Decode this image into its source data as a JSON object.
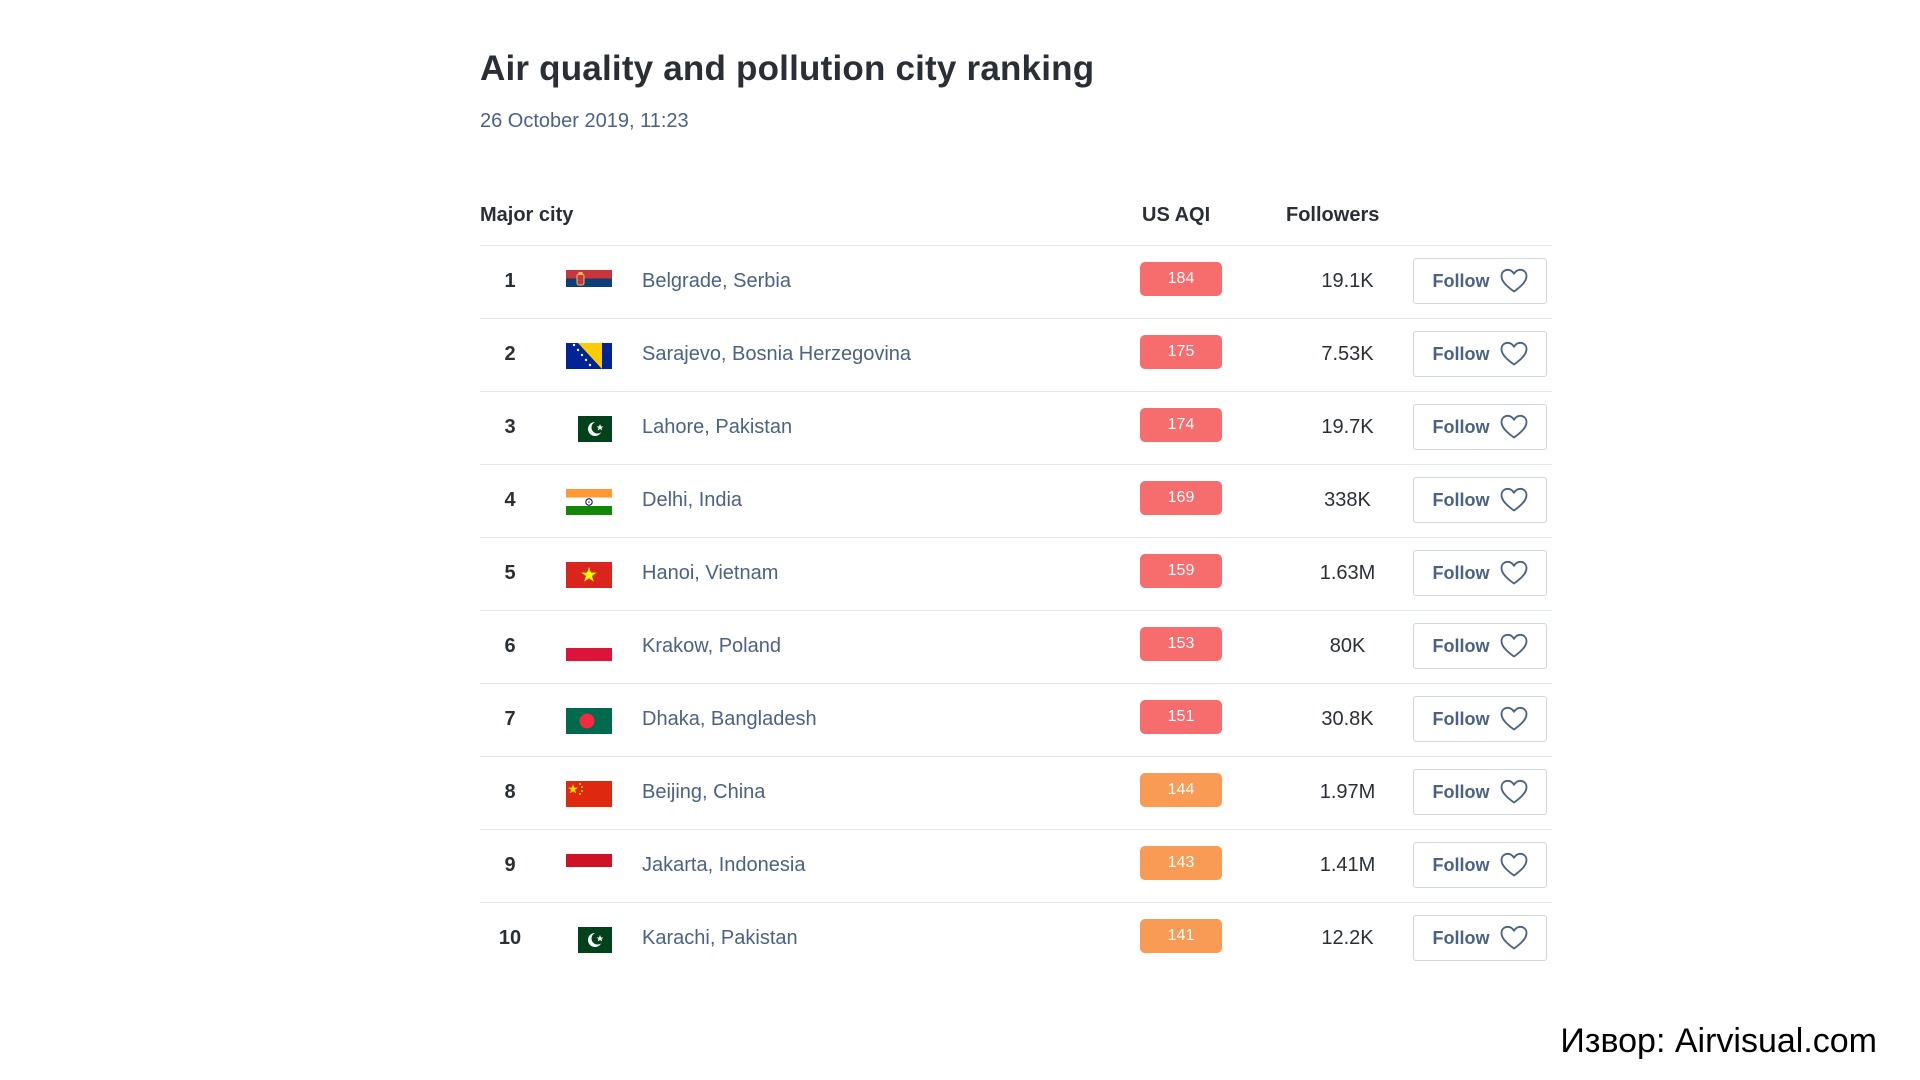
{
  "header": {
    "title": "Air quality and pollution city ranking",
    "date": "26 October 2019, 11:23"
  },
  "table": {
    "columns": {
      "city": "Major city",
      "aqi": "US AQI",
      "followers": "Followers"
    },
    "rows": [
      {
        "rank": "1",
        "flag": "serbia-flag",
        "city": "Belgrade, Serbia",
        "aqi": "184",
        "aqi_color": "#f76d6d",
        "followers": "19.1K",
        "follow_label": "Follow"
      },
      {
        "rank": "2",
        "flag": "bosnia-flag",
        "city": "Sarajevo, Bosnia Herzegovina",
        "aqi": "175",
        "aqi_color": "#f76d6d",
        "followers": "7.53K",
        "follow_label": "Follow"
      },
      {
        "rank": "3",
        "flag": "pakistan-flag",
        "city": "Lahore, Pakistan",
        "aqi": "174",
        "aqi_color": "#f76d6d",
        "followers": "19.7K",
        "follow_label": "Follow"
      },
      {
        "rank": "4",
        "flag": "india-flag",
        "city": "Delhi, India",
        "aqi": "169",
        "aqi_color": "#f76d6d",
        "followers": "338K",
        "follow_label": "Follow"
      },
      {
        "rank": "5",
        "flag": "vietnam-flag",
        "city": "Hanoi, Vietnam",
        "aqi": "159",
        "aqi_color": "#f76d6d",
        "followers": "1.63M",
        "follow_label": "Follow"
      },
      {
        "rank": "6",
        "flag": "poland-flag",
        "city": "Krakow, Poland",
        "aqi": "153",
        "aqi_color": "#f76d6d",
        "followers": "80K",
        "follow_label": "Follow"
      },
      {
        "rank": "7",
        "flag": "bangladesh-flag",
        "city": "Dhaka, Bangladesh",
        "aqi": "151",
        "aqi_color": "#f76d6d",
        "followers": "30.8K",
        "follow_label": "Follow"
      },
      {
        "rank": "8",
        "flag": "china-flag",
        "city": "Beijing, China",
        "aqi": "144",
        "aqi_color": "#fa9b55",
        "followers": "1.97M",
        "follow_label": "Follow"
      },
      {
        "rank": "9",
        "flag": "indonesia-flag",
        "city": "Jakarta, Indonesia",
        "aqi": "143",
        "aqi_color": "#fa9b55",
        "followers": "1.41M",
        "follow_label": "Follow"
      },
      {
        "rank": "10",
        "flag": "pakistan-flag",
        "city": "Karachi, Pakistan",
        "aqi": "141",
        "aqi_color": "#fa9b55",
        "followers": "12.2K",
        "follow_label": "Follow"
      }
    ]
  },
  "icons": {
    "follow": "heart-outline-icon"
  },
  "footer": {
    "source": "Извор: Airvisual.com"
  }
}
